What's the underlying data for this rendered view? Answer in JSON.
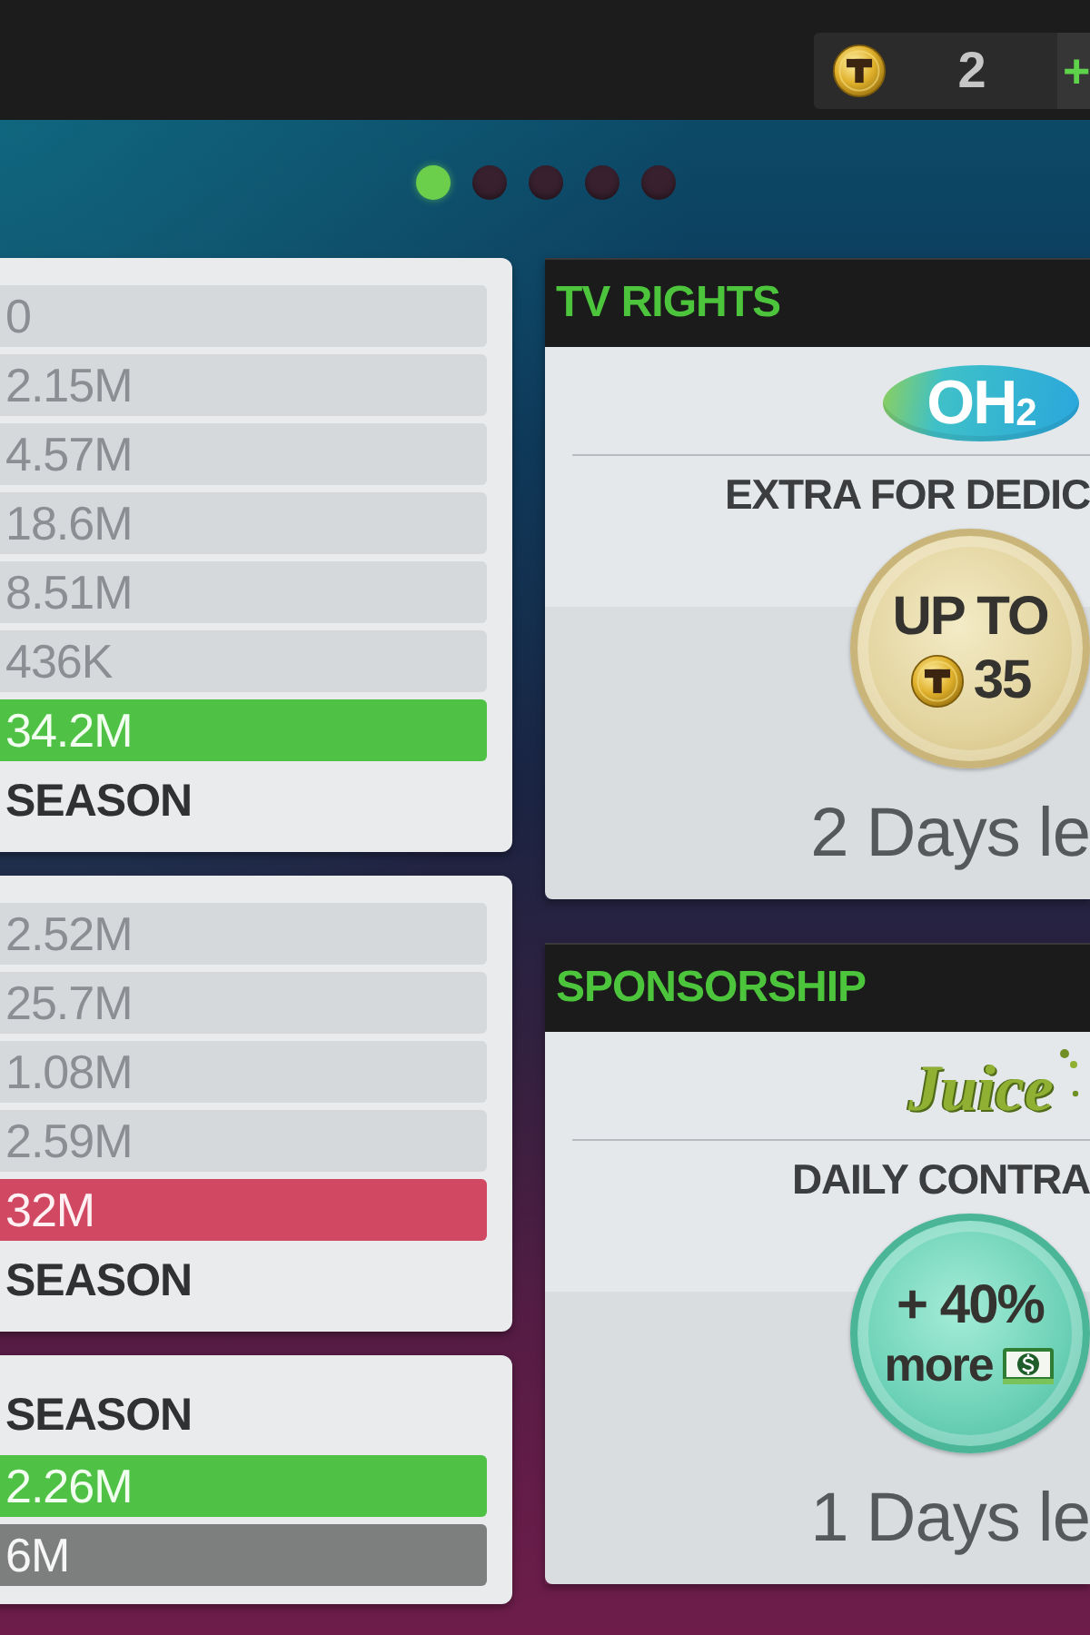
{
  "top_bar": {
    "coins": {
      "count": "2",
      "add_label": "+"
    }
  },
  "pager": [
    {
      "selected": true
    },
    {
      "selected": false
    },
    {
      "selected": false
    },
    {
      "selected": false
    },
    {
      "selected": false
    }
  ],
  "ledger_cards": [
    {
      "entries": [
        {
          "kind": "plain",
          "value": "0"
        },
        {
          "kind": "plain",
          "value": "2.15M"
        },
        {
          "kind": "plain",
          "value": "4.57M"
        },
        {
          "kind": "plain",
          "value": "18.6M"
        },
        {
          "kind": "plain",
          "value": "8.51M"
        },
        {
          "kind": "plain",
          "value": "436K"
        },
        {
          "kind": "positive",
          "value": "34.2M"
        },
        {
          "kind": "label",
          "value": "SEASON"
        }
      ]
    },
    {
      "entries": [
        {
          "kind": "plain",
          "value": "2.52M"
        },
        {
          "kind": "plain",
          "value": "25.7M"
        },
        {
          "kind": "plain",
          "value": "1.08M"
        },
        {
          "kind": "plain",
          "value": "2.59M"
        },
        {
          "kind": "negative",
          "value": "32M"
        },
        {
          "kind": "label",
          "value": "SEASON"
        }
      ]
    },
    {
      "entries": [
        {
          "kind": "label",
          "value": "SEASON"
        },
        {
          "kind": "positive",
          "value": "2.26M"
        },
        {
          "kind": "neutral",
          "value": "6M"
        }
      ]
    }
  ],
  "offers": [
    {
      "title": "TV RIGHTS",
      "logo": {
        "kind": "badge",
        "text": "OH$_{2}$"
      },
      "headline": "EXTRA FOR DEDIC",
      "seal": {
        "kind": "coins",
        "line_1": "UP TO",
        "line_2": "35"
      },
      "time_left": "2 Days le"
    },
    {
      "title": "SPONSORSHIP",
      "logo": {
        "kind": "script",
        "text": "Juice"
      },
      "headline": "DAILY CONTRA",
      "seal": {
        "kind": "cash",
        "line_1": "+ 40%",
        "line_2": "more"
      },
      "time_left": "1 Days le"
    }
  ]
}
